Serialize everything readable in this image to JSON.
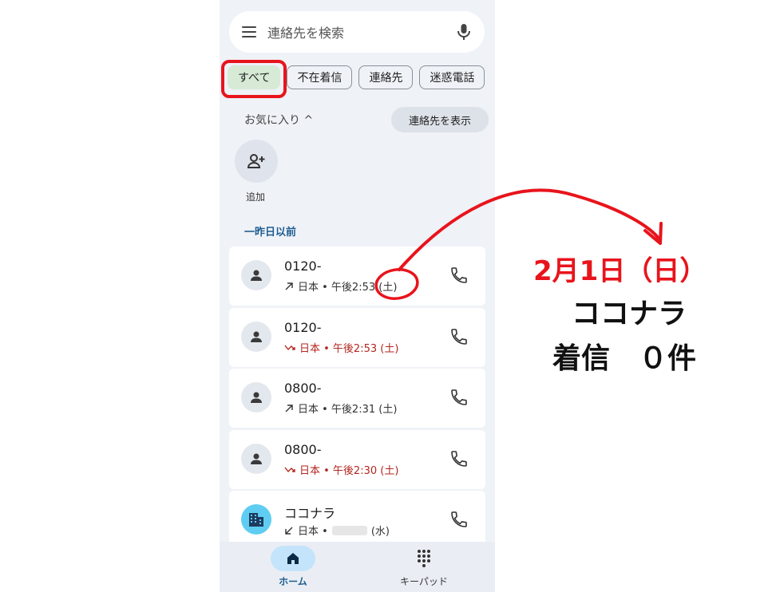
{
  "search": {
    "placeholder": "連絡先を検索",
    "menu_icon": "hamburger-icon",
    "mic_icon": "microphone-icon"
  },
  "chips": [
    {
      "label": "すべて",
      "selected": true
    },
    {
      "label": "不在着信",
      "selected": false
    },
    {
      "label": "連絡先",
      "selected": false
    },
    {
      "label": "迷惑電話",
      "selected": false
    }
  ],
  "favorites": {
    "title": "お気に入り ^",
    "show_contacts": "連絡先を表示",
    "add_label": "追加"
  },
  "section_label": "一昨日以前",
  "calls": [
    {
      "number": "0120-",
      "detail": "日本 • 午後2:53 (土)",
      "type": "outgoing",
      "avatar": "person-icon"
    },
    {
      "number": "0120-",
      "detail": "日本 • 午後2:53 (土)",
      "type": "missed",
      "avatar": "person-icon"
    },
    {
      "number": "0800-",
      "detail": "日本 • 午後2:31 (土)",
      "type": "outgoing",
      "avatar": "person-icon"
    },
    {
      "number": "0800-",
      "detail": "日本 • 午後2:30 (土)",
      "type": "missed",
      "avatar": "person-icon"
    },
    {
      "number": "ココナラ",
      "detail": "日本 •",
      "detail_suffix": "(水)",
      "type": "incoming",
      "avatar": "building-icon"
    }
  ],
  "bottom_nav": {
    "home": "ホーム",
    "keypad": "キーパッド"
  },
  "annotation": {
    "date": "2月1日（日）",
    "name": "ココナラ",
    "count": "着信　０件"
  },
  "colors": {
    "accent_red": "#e8141c",
    "missed_red": "#b3261e",
    "chip_selected": "#d6ead6",
    "section_blue": "#1d5d91"
  }
}
